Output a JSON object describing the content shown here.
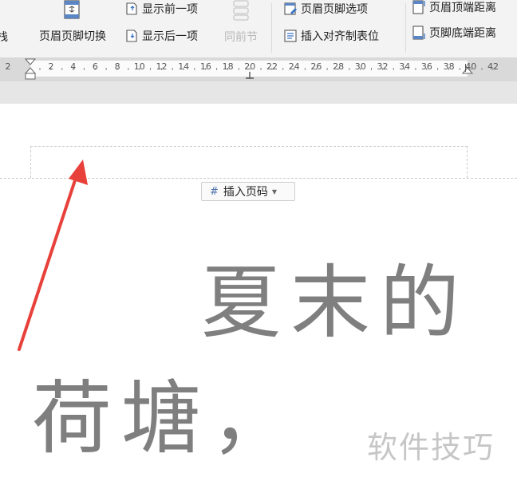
{
  "ribbon": {
    "cut_label": "栈",
    "header_footer_switch": "页眉页脚切换",
    "show_previous": "显示前一项",
    "show_next": "显示后一项",
    "same_as_previous": "同前节",
    "header_footer_options": "页眉页脚选项",
    "insert_align_tab": "插入对齐制表位",
    "header_top_distance": "页眉顶端距离",
    "footer_bottom_distance": "页脚底端距离"
  },
  "ruler": {
    "labels": [
      "2",
      "2",
      "4",
      "6",
      "8",
      "10",
      "12",
      "14",
      "16",
      "18",
      "20",
      "22",
      "24",
      "26",
      "28",
      "30",
      "32",
      "34",
      "36",
      "38",
      "40",
      "42"
    ]
  },
  "page": {
    "insert_page_number": "插入页码",
    "line1": "夏末的",
    "line2": "荷塘，",
    "watermark": "软件技巧"
  },
  "colors": {
    "arrow": "#e8403a",
    "body_text": "#7f7f7f",
    "ribbon_bg": "#f3f3f3"
  }
}
